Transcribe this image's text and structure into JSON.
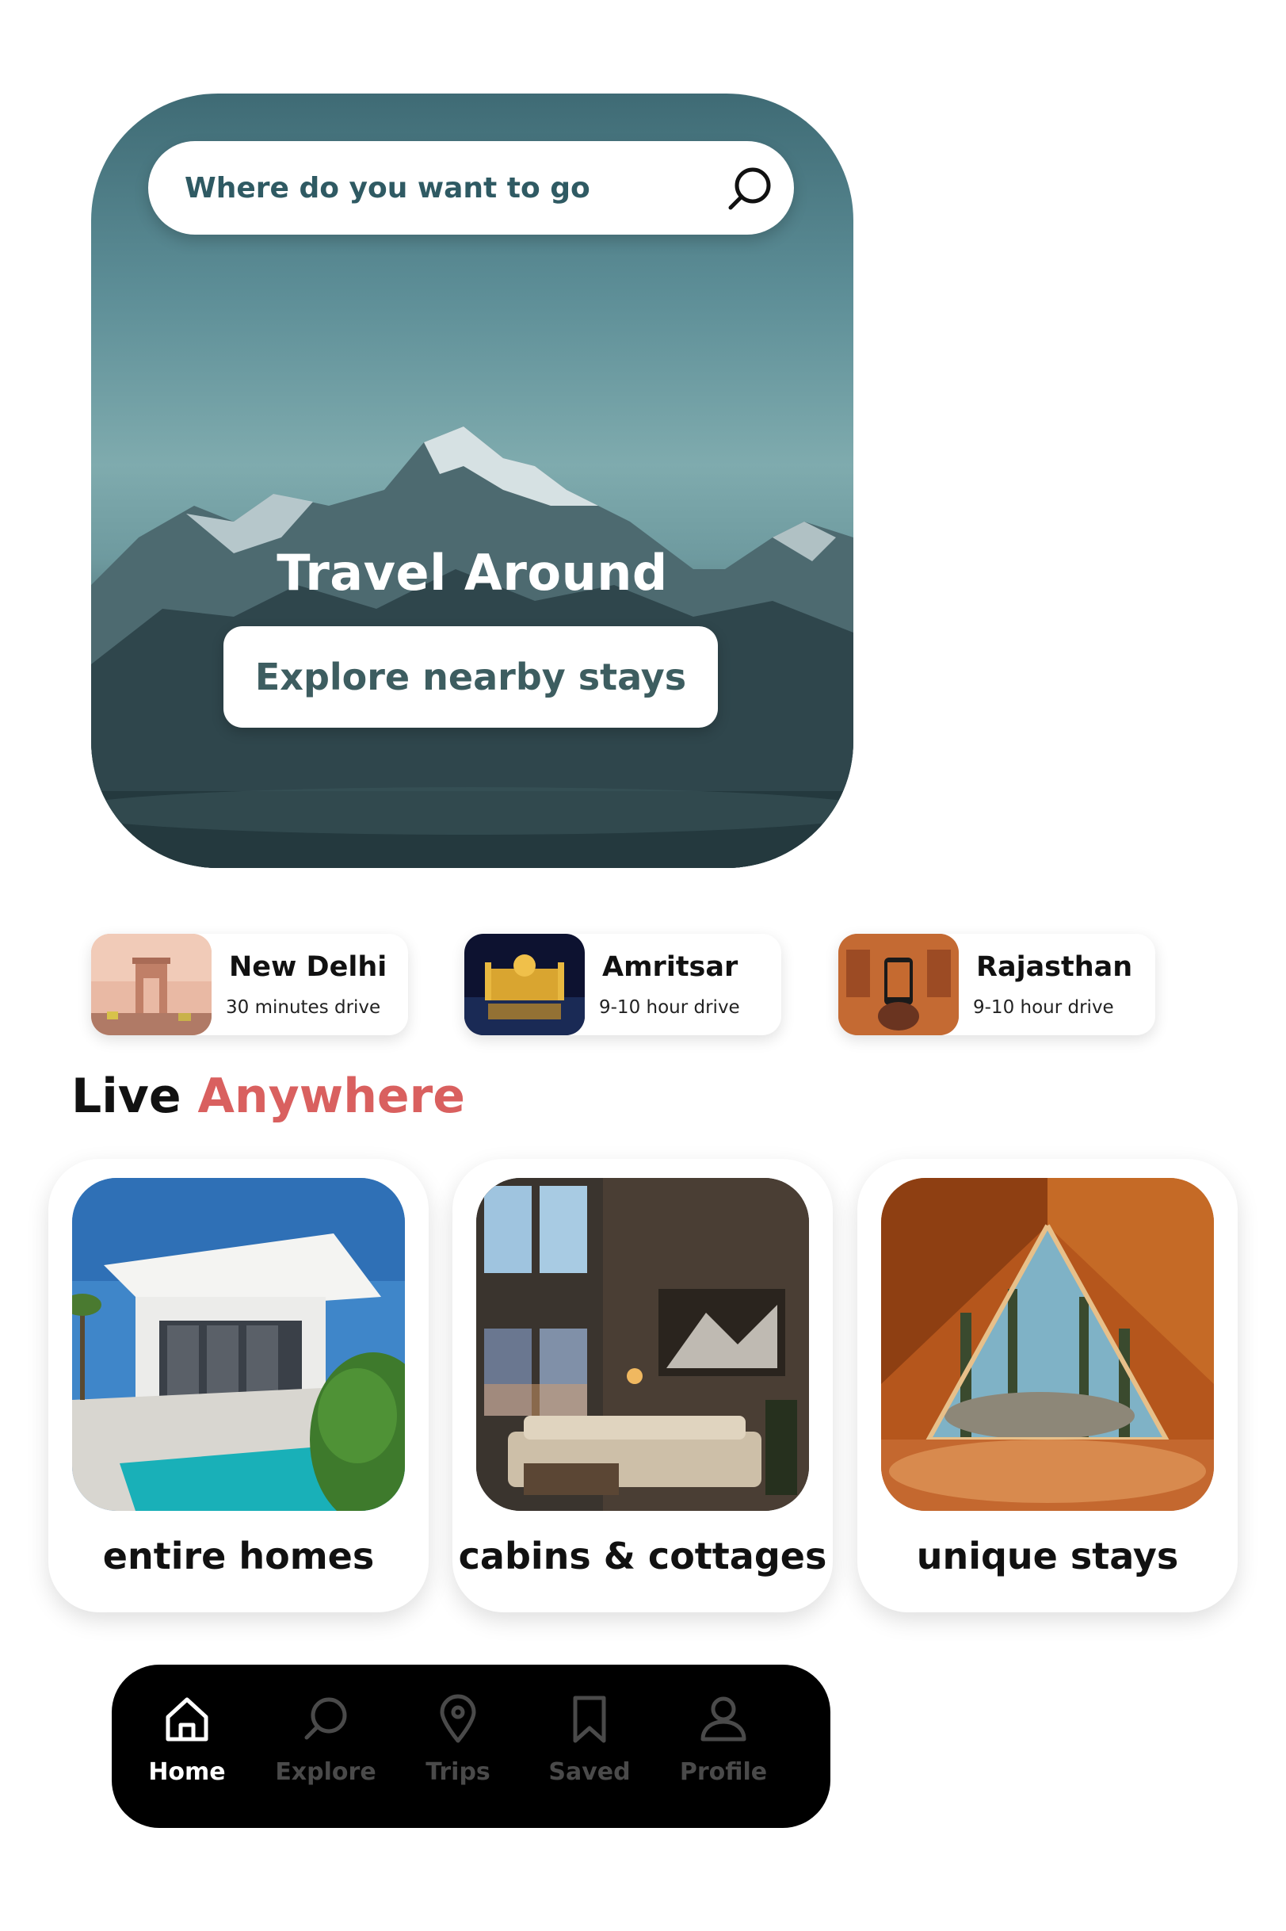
{
  "search": {
    "placeholder": "Where do you want to go"
  },
  "hero": {
    "title": "Travel Around",
    "button_label": "Explore nearby stays"
  },
  "destinations": [
    {
      "name": "New Delhi",
      "subtitle": "30 minutes drive"
    },
    {
      "name": "Amritsar",
      "subtitle": "9-10 hour drive"
    },
    {
      "name": "Rajasthan",
      "subtitle": "9-10 hour drive"
    }
  ],
  "section": {
    "title_part1": "Live ",
    "title_part2": "Anywhere",
    "accent_color": "#d9605f"
  },
  "stays": [
    {
      "label": "entire homes"
    },
    {
      "label": "cabins & cottages"
    },
    {
      "label": "unique stays"
    }
  ],
  "nav": {
    "items": [
      {
        "label": "Home",
        "icon": "home-icon",
        "active": true
      },
      {
        "label": "Explore",
        "icon": "search-icon",
        "active": false
      },
      {
        "label": "Trips",
        "icon": "map-pin-icon",
        "active": false
      },
      {
        "label": "Saved",
        "icon": "bookmark-icon",
        "active": false
      },
      {
        "label": "Profile",
        "icon": "user-icon",
        "active": false
      }
    ]
  }
}
